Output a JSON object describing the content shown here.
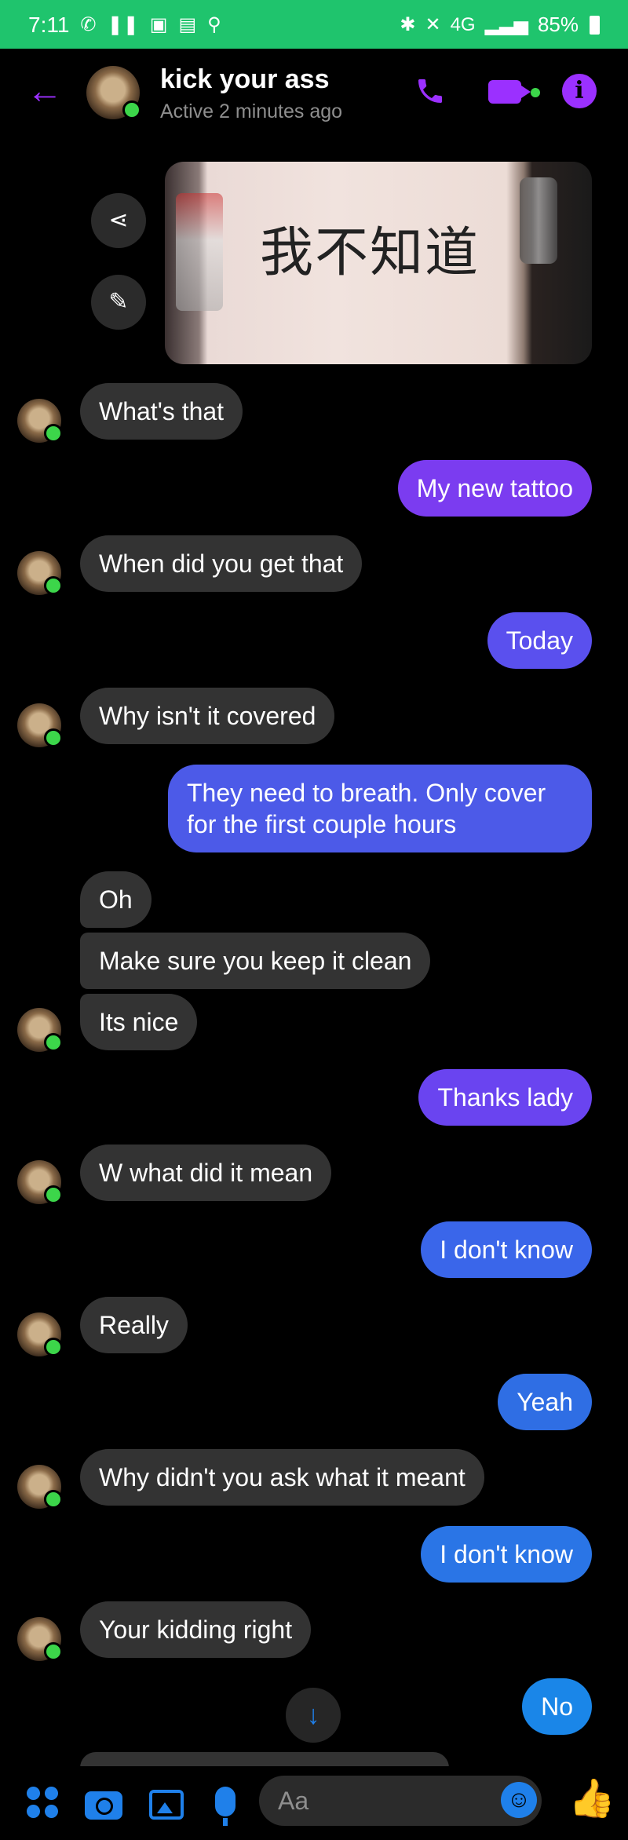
{
  "status_bar": {
    "time": "7:11",
    "battery": "85%",
    "signal_text": "4G"
  },
  "header": {
    "back_icon": "arrow-left-icon",
    "contact_name": "kick your ass",
    "status": "Active 2 minutes ago",
    "accent_color": "#9b30ff"
  },
  "image_message": {
    "tattoo_text": "我不知道"
  },
  "messages": [
    {
      "side": "in",
      "text": "What's that"
    },
    {
      "side": "out",
      "text": "My new tattoo"
    },
    {
      "side": "in",
      "text": "When did you get that"
    },
    {
      "side": "out",
      "text": "Today"
    },
    {
      "side": "in",
      "text": "Why isn't it covered"
    },
    {
      "side": "out",
      "text": "They need to breath. Only cover for the first couple hours"
    },
    {
      "side": "in",
      "text": "Oh"
    },
    {
      "side": "in",
      "text": "Make sure you keep it clean"
    },
    {
      "side": "in",
      "text": "Its nice"
    },
    {
      "side": "out",
      "text": "Thanks lady"
    },
    {
      "side": "in",
      "text": "W what did it mean"
    },
    {
      "side": "out",
      "text": "I don't know"
    },
    {
      "side": "in",
      "text": "Really"
    },
    {
      "side": "out",
      "text": "Yeah"
    },
    {
      "side": "in",
      "text": "Why didn't you ask what it meant"
    },
    {
      "side": "out",
      "text": "I don't know"
    },
    {
      "side": "in",
      "text": "Your kidding right"
    },
    {
      "side": "out",
      "text": "No"
    }
  ],
  "composer": {
    "placeholder": "Aa"
  }
}
